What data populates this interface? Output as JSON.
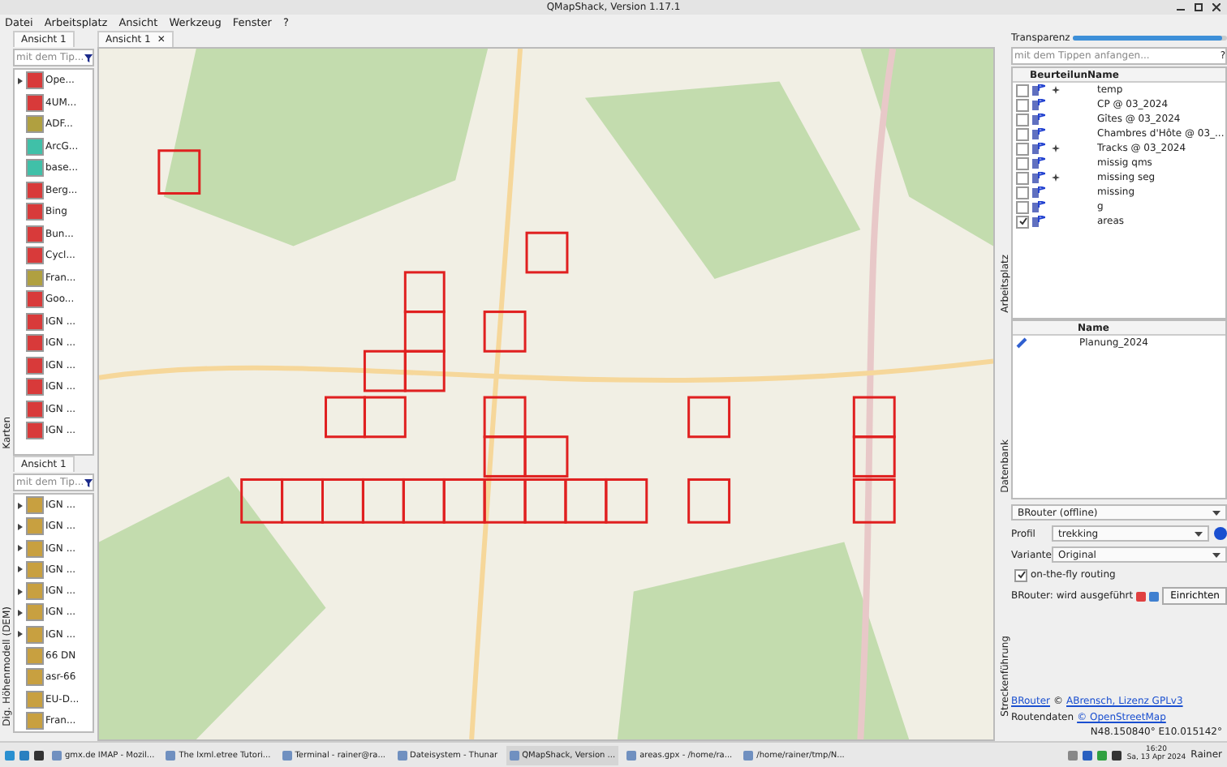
{
  "window": {
    "title": "QMapShack, Version 1.17.1"
  },
  "menu": [
    "Datei",
    "Arbeitsplatz",
    "Ansicht",
    "Werkzeug",
    "Fenster",
    "?"
  ],
  "maps_dock": {
    "label": "Karten",
    "tab": "Ansicht 1",
    "filter": {
      "placeholder": "mit dem Tip..."
    },
    "items": [
      {
        "name": "Ope...",
        "kind": "raster",
        "expandable": true
      },
      {
        "name": "4UM...",
        "kind": "raster",
        "expandable": false
      },
      {
        "name": "ADF...",
        "kind": "vector",
        "expandable": false
      },
      {
        "name": "ArcG...",
        "kind": "online",
        "expandable": false
      },
      {
        "name": "base...",
        "kind": "online",
        "expandable": false
      },
      {
        "name": "Berg...",
        "kind": "raster",
        "expandable": false
      },
      {
        "name": "Bing",
        "kind": "raster",
        "expandable": false
      },
      {
        "name": "Bun...",
        "kind": "raster",
        "expandable": false
      },
      {
        "name": "Cycl...",
        "kind": "raster",
        "expandable": false
      },
      {
        "name": "Fran...",
        "kind": "vector",
        "expandable": false
      },
      {
        "name": "Goo...",
        "kind": "raster",
        "expandable": false
      },
      {
        "name": "IGN ...",
        "kind": "raster",
        "expandable": false
      },
      {
        "name": "IGN ...",
        "kind": "raster",
        "expandable": false
      },
      {
        "name": "IGN ...",
        "kind": "raster",
        "expandable": false
      },
      {
        "name": "IGN ...",
        "kind": "raster",
        "expandable": false
      },
      {
        "name": "IGN ...",
        "kind": "raster",
        "expandable": false
      },
      {
        "name": "IGN ...",
        "kind": "raster",
        "expandable": false
      }
    ]
  },
  "dem_dock": {
    "label": "Dig. Höhenmodell (DEM)",
    "tab": "Ansicht 1",
    "filter": {
      "placeholder": "mit dem Tip..."
    },
    "items": [
      {
        "name": "IGN ...",
        "expandable": true
      },
      {
        "name": "IGN ...",
        "expandable": true
      },
      {
        "name": "IGN ...",
        "expandable": true
      },
      {
        "name": "IGN ...",
        "expandable": true
      },
      {
        "name": "IGN ...",
        "expandable": true
      },
      {
        "name": "IGN ...",
        "expandable": true
      },
      {
        "name": "IGN ...",
        "expandable": true
      },
      {
        "name": "66 DN",
        "expandable": false
      },
      {
        "name": "asr-66",
        "expandable": false
      },
      {
        "name": "EU-D...",
        "expandable": false
      },
      {
        "name": "Fran...",
        "expandable": false
      }
    ]
  },
  "map_view": {
    "tab": "Ansicht 1",
    "close": "✕"
  },
  "workspace_dock": {
    "label": "Arbeitsplatz",
    "transparency": {
      "label": "Transparenz",
      "level": 0.97
    },
    "filter": {
      "placeholder": "mit dem Tippen anfangen...",
      "help": "?"
    },
    "columns": [
      "Beurteilun",
      "Name"
    ],
    "items": [
      {
        "name": "temp",
        "checked": false,
        "starred": true
      },
      {
        "name": "CP @ 03_2024",
        "checked": false,
        "starred": false
      },
      {
        "name": "Gîtes @ 03_2024",
        "checked": false,
        "starred": false
      },
      {
        "name": "Chambres d'Hôte @ 03_...",
        "checked": false,
        "starred": false
      },
      {
        "name": "Tracks @ 03_2024",
        "checked": false,
        "starred": true
      },
      {
        "name": "missig qms",
        "checked": false,
        "starred": false
      },
      {
        "name": "missing seg",
        "checked": false,
        "starred": true
      },
      {
        "name": "missing",
        "checked": false,
        "starred": false
      },
      {
        "name": "g",
        "checked": false,
        "starred": false
      },
      {
        "name": "areas",
        "checked": true,
        "starred": false
      }
    ]
  },
  "database_dock": {
    "label": "Datenbank",
    "columns": [
      "Name"
    ],
    "items": [
      "Planung_2024"
    ]
  },
  "routing_dock": {
    "label": "Streckenführung",
    "router": "BRouter (offline)",
    "profile_label": "Profil",
    "profile": "trekking",
    "variant_label": "Variante",
    "variant": "Original",
    "on_the_fly": {
      "label": "on-the-fly routing",
      "checked": true
    },
    "status": "BRouter: wird ausgeführt",
    "setup_button": "Einrichten",
    "credits": [
      {
        "parts": [
          {
            "text": "BRouter",
            "link": true
          },
          {
            "text": "©",
            "link": false
          },
          {
            "text": "ABrensch, Lizenz GPLv3",
            "link": true
          }
        ]
      },
      {
        "parts": [
          {
            "text": "Routendaten",
            "link": false
          },
          {
            "text": "© OpenStreetMap",
            "link": true
          }
        ]
      }
    ]
  },
  "status_bar": {
    "coordinates": "N48.150840° E10.015142°"
  },
  "taskbar": {
    "tasks": [
      "gmx.de IMAP - Mozil...",
      "The lxml.etree Tutori...",
      "Terminal - rainer@ra...",
      "Dateisystem - Thunar",
      "QMapShack, Version ...",
      "areas.gpx - /home/ra...",
      "/home/rainer/tmp/N..."
    ],
    "time": "16:20",
    "date": "Sa, 13 Apr 2024",
    "user": "Rainer"
  }
}
